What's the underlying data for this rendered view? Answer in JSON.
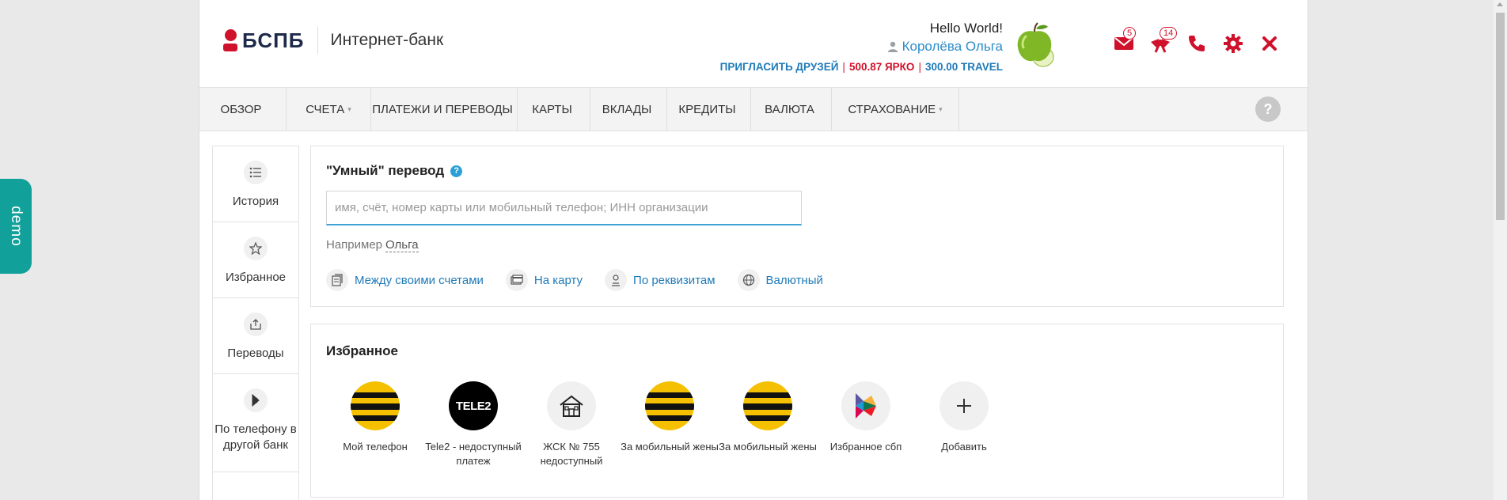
{
  "header": {
    "logo_text": "БСПБ",
    "logo_subtitle": "Интернет-банк",
    "greeting": "Hello World!",
    "user_name": "Королёва Ольга",
    "invite_label": "ПРИГЛАСИТЬ ДРУЗЕЙ",
    "bonus_yarko": "500.87 ЯРКО",
    "bonus_travel": "300.00 TRAVEL",
    "messages_count": "5",
    "offers_count": "14",
    "icons": [
      "mail-icon",
      "gift-icon",
      "phone-icon",
      "gear-icon",
      "close-icon"
    ],
    "accent_color": "#d0112b"
  },
  "nav": {
    "items": [
      {
        "label": "ОБЗОР",
        "caret": ""
      },
      {
        "label": "СЧЕТА",
        "caret": "▾"
      },
      {
        "label": "ПЛАТЕЖИ И ПЕРЕВОДЫ",
        "caret": ""
      },
      {
        "label": "КАРТЫ",
        "caret": ""
      },
      {
        "label": "ВКЛАДЫ",
        "caret": ""
      },
      {
        "label": "КРЕДИТЫ",
        "caret": ""
      },
      {
        "label": "ВАЛЮТА",
        "caret": ""
      },
      {
        "label": "СТРАХОВАНИЕ",
        "caret": "▾"
      }
    ],
    "help_label": "?"
  },
  "sidebar": {
    "items": [
      {
        "label": "История",
        "icon": "list-icon"
      },
      {
        "label": "Избранное",
        "icon": "star-icon"
      },
      {
        "label": "Переводы",
        "icon": "transfer-icon"
      },
      {
        "label": "По телефону в другой банк",
        "icon": "sbp-icon"
      }
    ]
  },
  "smart_transfer": {
    "title": "\"Умный\" перевод",
    "help_icon": "?",
    "search_placeholder": "имя, счёт, номер карты или мобильный телефон; ИНН организации",
    "example_prefix": "Например",
    "example_name": "Ольга",
    "links": [
      {
        "label": "Между своими счетами",
        "icon": "accounts-icon"
      },
      {
        "label": "На карту",
        "icon": "card-icon"
      },
      {
        "label": "По реквизитам",
        "icon": "requisites-icon"
      },
      {
        "label": "Валютный",
        "icon": "globe-icon"
      }
    ]
  },
  "favorites": {
    "title": "Избранное",
    "items": [
      {
        "label": "Мой телефон",
        "icon": "beeline-icon"
      },
      {
        "label": "Tele2 - недоступный платеж",
        "icon": "tele2-icon",
        "logo_text": "TELE2"
      },
      {
        "label": "ЖСК № 755 недоступный",
        "icon": "house-icon"
      },
      {
        "label": "За мобильный жены",
        "icon": "beeline-icon"
      },
      {
        "label": "За мобильный жены",
        "icon": "beeline-icon"
      },
      {
        "label": "Избранное сбп",
        "icon": "sbp-logo-icon"
      },
      {
        "label": "Добавить",
        "icon": "plus-icon"
      }
    ]
  },
  "demo_tab": "demo"
}
